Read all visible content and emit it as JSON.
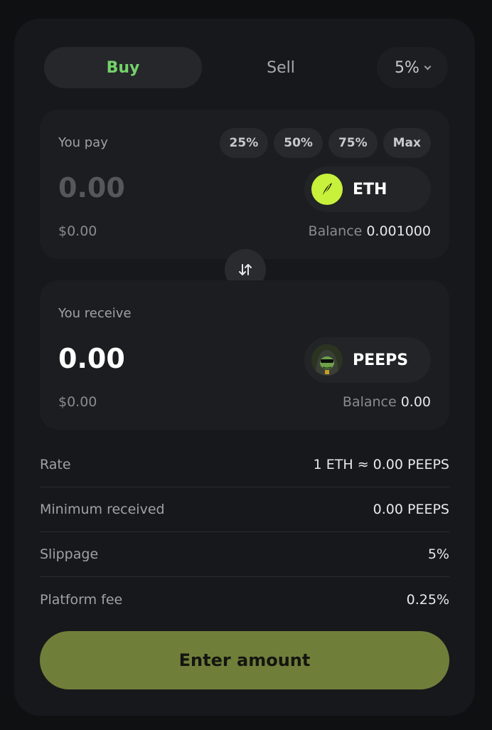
{
  "tabs": {
    "buy": "Buy",
    "sell": "Sell",
    "active": "buy"
  },
  "slippage_selector": {
    "value": "5%"
  },
  "pay": {
    "label": "You pay",
    "presets": [
      "25%",
      "50%",
      "75%",
      "Max"
    ],
    "amount_placeholder": "0.00",
    "usd": "$0.00",
    "token": "ETH",
    "balance_label": "Balance",
    "balance_value": "0.001000"
  },
  "receive": {
    "label": "You receive",
    "amount": "0.00",
    "usd": "$0.00",
    "token": "PEEPS",
    "balance_label": "Balance",
    "balance_value": "0.00"
  },
  "details": [
    {
      "label": "Rate",
      "value": "1 ETH ≈ 0.00 PEEPS"
    },
    {
      "label": "Minimum received",
      "value": "0.00 PEEPS"
    },
    {
      "label": "Slippage",
      "value": "5%"
    },
    {
      "label": "Platform fee",
      "value": "0.25%"
    }
  ],
  "cta": {
    "label": "Enter amount"
  },
  "colors": {
    "accent_green": "#74d26a",
    "cta_bg": "#6f7f3a",
    "eth_logo_bg": "#c7f13a"
  },
  "icons": {
    "swap": "swap-arrows-icon",
    "chevron": "chevron-down-icon",
    "eth": "eth-token-icon",
    "peeps": "peeps-token-icon"
  }
}
